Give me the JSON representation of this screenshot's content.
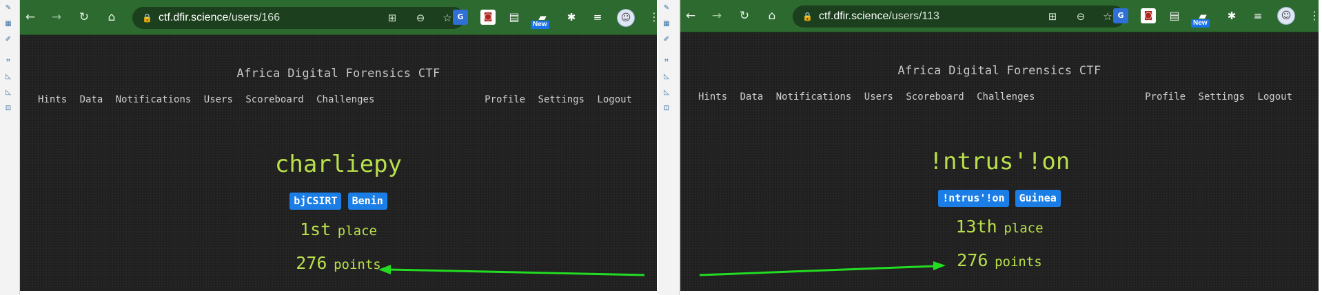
{
  "colors": {
    "browser_frame": "#2d6a2f",
    "page_background": "#202020",
    "accent_green": "#b8e04a",
    "badge_blue": "#1b7ee6",
    "menu_text": "#cfcfcf",
    "arrow": "#22dd22"
  },
  "left_tool_icons": [
    "spellcheck-icon",
    "table-icon",
    "edit-icon",
    "crop-icon",
    "chart-icon",
    "chart-icon",
    "select-icon"
  ],
  "browser_icons": [
    "back-icon",
    "forward-icon",
    "reload-icon",
    "home-icon",
    "lock-icon",
    "translate-icon",
    "zoom-out-icon",
    "star-icon",
    "google-translate-extension-icon",
    "mask-extension-icon",
    "document-extension-icon",
    "new-extension-icon",
    "puzzle-icon",
    "playlist-icon",
    "avatar-icon",
    "kebab-menu-icon"
  ],
  "new_badge": "New",
  "left": {
    "url_host": "ctf.dfir.science",
    "url_path": "/users/166",
    "site_title": "Africa Digital Forensics CTF",
    "nav_left": [
      "Hints",
      "Data",
      "Notifications",
      "Users",
      "Scoreboard",
      "Challenges"
    ],
    "nav_right": [
      "Profile",
      "Settings",
      "Logout"
    ],
    "username": "charliepy",
    "badges": [
      "bjCSIRT",
      "Benin"
    ],
    "place_value": "1st",
    "place_label": "place",
    "points_value": "276",
    "points_label": "points"
  },
  "right": {
    "url_host": "ctf.dfir.science",
    "url_path": "/users/113",
    "site_title": "Africa Digital Forensics CTF",
    "nav_left": [
      "Hints",
      "Data",
      "Notifications",
      "Users",
      "Scoreboard",
      "Challenges"
    ],
    "nav_right": [
      "Profile",
      "Settings",
      "Logout"
    ],
    "username": "!ntrus'!on",
    "badges": [
      "!ntrus'!on",
      "Guinea"
    ],
    "place_value": "13th",
    "place_label": "place",
    "points_value": "276",
    "points_label": "points"
  }
}
